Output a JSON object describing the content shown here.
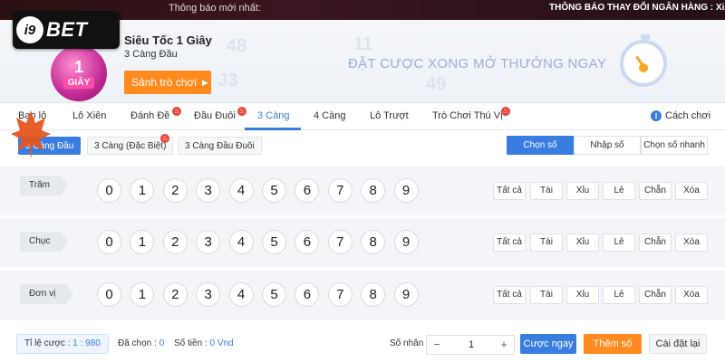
{
  "topbar": {
    "notice_label": "Thông báo mới nhất:",
    "notice_text": "THÔNG BÁO THAY ĐỔI NGÂN HÀNG :   Xi"
  },
  "logo": {
    "mark": "i9",
    "word": "BET"
  },
  "game": {
    "badge_number": "1",
    "badge_unit": "GIÂY",
    "title": "Siêu Tốc 1 Giây",
    "subtitle": "3 Càng Đầu",
    "lobby_button": "Sảnh trò chơi",
    "slogan": "ĐẶT CƯỢC XONG MỞ THƯỞNG NGAY"
  },
  "tabs": [
    {
      "label": "Bao lô",
      "hot": false
    },
    {
      "label": "Lô Xiên",
      "hot": false
    },
    {
      "label": "Đánh Đề",
      "hot": true
    },
    {
      "label": "Đầu Đuôi",
      "hot": true
    },
    {
      "label": "3 Càng",
      "hot": false,
      "active": true
    },
    {
      "label": "4 Càng",
      "hot": false
    },
    {
      "label": "Lô Trượt",
      "hot": false
    },
    {
      "label": "Trò Chơi Thú Vị",
      "hot": true
    }
  ],
  "help_label": "Cách chơi",
  "subtabs": [
    {
      "label": "3 Càng Đầu",
      "active": true
    },
    {
      "label": "3 Càng (Đặc Biệt)",
      "hot": true
    },
    {
      "label": "3 Càng Đầu Đuôi"
    }
  ],
  "modes": [
    {
      "label": "Chọn số",
      "active": true
    },
    {
      "label": "Nhập số"
    },
    {
      "label": "Chọn số nhanh"
    }
  ],
  "rows": [
    {
      "label": "Trăm"
    },
    {
      "label": "Chục"
    },
    {
      "label": "Đơn vị"
    }
  ],
  "digits": [
    "0",
    "1",
    "2",
    "3",
    "4",
    "5",
    "6",
    "7",
    "8",
    "9"
  ],
  "quick_buttons": [
    "Tất cả",
    "Tài",
    "Xỉu",
    "Lẻ",
    "Chẵn",
    "Xóa"
  ],
  "footer": {
    "rate_label": "Tỉ lệ cược :",
    "rate_value": "1 : 980",
    "chosen_label": "Đã chọn :",
    "chosen_value": "0",
    "money_label": "Số tiền :",
    "money_value": "0 Vnd",
    "multiplier_label": "Số nhân :",
    "multiplier_value": "1",
    "bet_now": "Cược ngay",
    "add_number": "Thêm số",
    "reset": "Cài đặt lại"
  },
  "colors": {
    "accent": "#3a7de0",
    "orange": "#ff8a1e",
    "hot": "#e8443a"
  }
}
